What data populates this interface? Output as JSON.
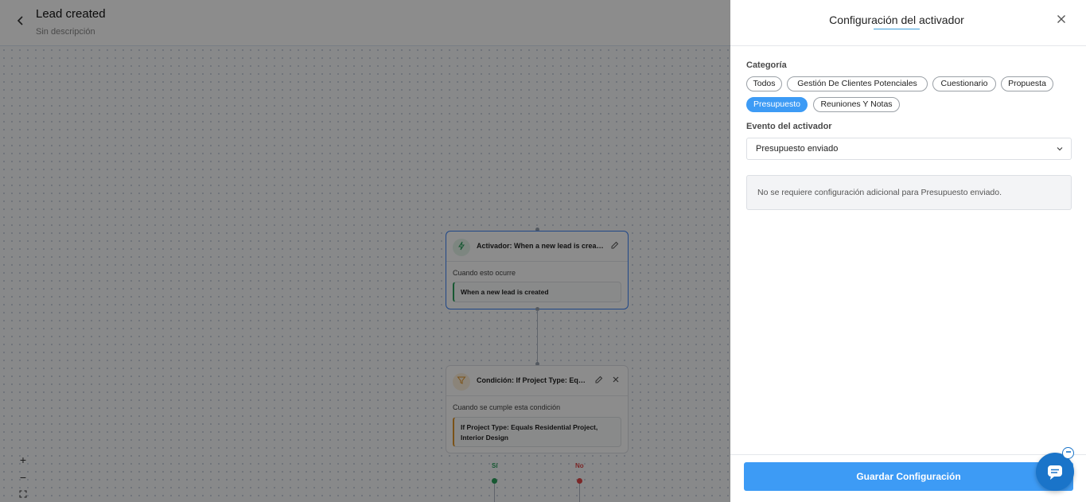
{
  "workflow": {
    "title": "Lead created",
    "description": "Sin descripción"
  },
  "nodes": {
    "trigger": {
      "title": "Activador: When a new lead is creat...",
      "subtitle": "Cuando esto ocurre",
      "value": "When a new lead is created"
    },
    "condition": {
      "title": "Condición: If Project Type: Equa...",
      "subtitle": "Cuando se cumple esta condición",
      "value": "If Project Type: Equals Residential Project, Interior Design"
    },
    "branches": {
      "yes": "Sí",
      "no": "No"
    }
  },
  "zoom": {
    "in": "+",
    "out": "−"
  },
  "panel": {
    "title": "Configuración del activador",
    "category_label": "Categoría",
    "categories": [
      "Todos",
      "Gestión De Clientes Potenciales",
      "Cuestionario",
      "Propuesta",
      "Presupuesto",
      "Reuniones Y Notas"
    ],
    "selected_category": "Presupuesto",
    "event_label": "Evento del activador",
    "event_value": "Presupuesto enviado",
    "info": "No se requiere configuración adicional para Presupuesto enviado.",
    "save_label": "Guardar Configuración"
  },
  "colors": {
    "accent": "#3d9bf5",
    "trigger_icon": "#2aa05c",
    "condition_icon": "#e0962a",
    "branch_yes": "#2aa05c",
    "branch_no": "#e04848"
  },
  "icons": {
    "back": "chevron-left-icon",
    "trigger": "lightning-icon",
    "condition": "filter-icon",
    "edit": "pencil-icon",
    "close": "close-icon",
    "chat": "chat-icon"
  }
}
